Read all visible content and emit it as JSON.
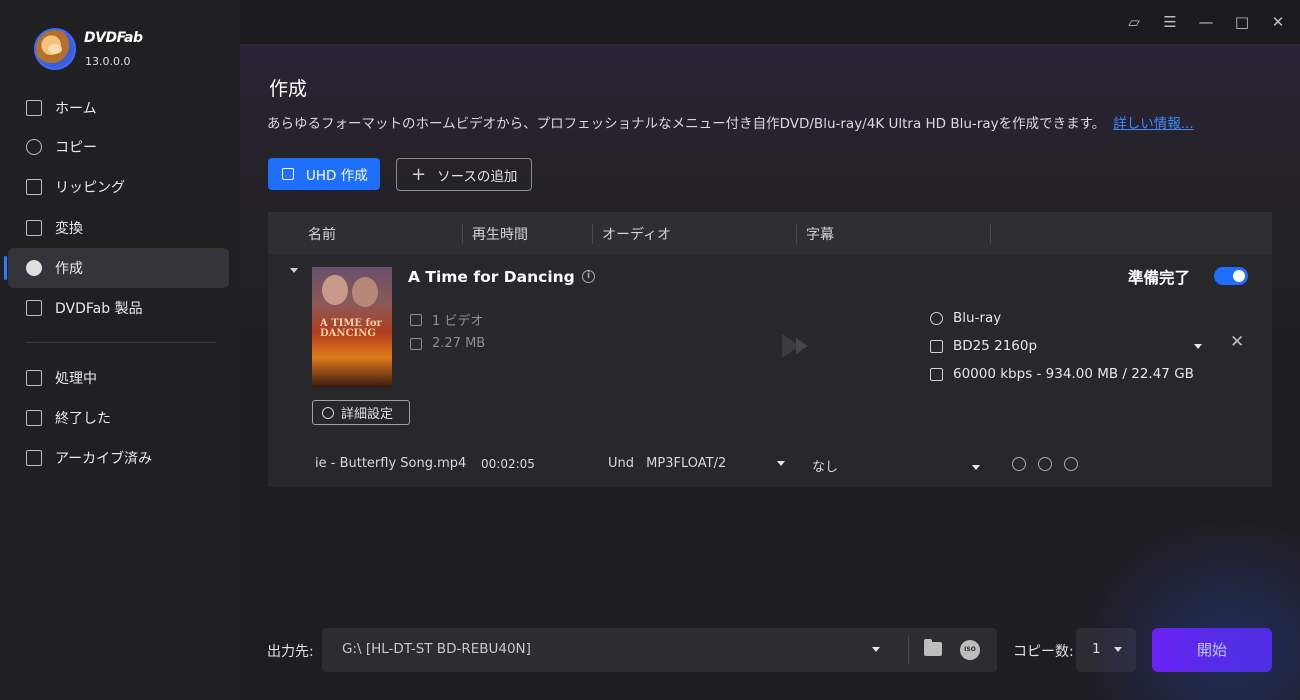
{
  "app": {
    "brand": "DVDFab",
    "version": "13.0.0.0"
  },
  "sidebar": {
    "items": [
      {
        "label": "ホーム",
        "icon": "home-icon"
      },
      {
        "label": "コピー",
        "icon": "copy-icon"
      },
      {
        "label": "リッピング",
        "icon": "ripping-icon"
      },
      {
        "label": "変換",
        "icon": "film-icon"
      },
      {
        "label": "作成",
        "icon": "disc-icon",
        "active": true
      },
      {
        "label": "DVDFab 製品",
        "icon": "product-icon"
      },
      {
        "label": "処理中",
        "icon": "processing-icon"
      },
      {
        "label": "終了した",
        "icon": "finished-icon"
      },
      {
        "label": "アーカイブ済み",
        "icon": "archive-icon"
      }
    ]
  },
  "titlebar": {
    "icons": [
      "skin-icon",
      "menu-icon",
      "minimize-icon",
      "maximize-icon",
      "close-icon"
    ]
  },
  "main": {
    "title": "作成",
    "description": "あらゆるフォーマットのホームビデオから、プロフェッショナルなメニュー付き自作DVD/Blu-ray/4K Ultra HD Blu-rayを作成できます。",
    "more_link": "詳しい情報...",
    "uhd_button": "UHD 作成",
    "add_source_button": "ソースの追加"
  },
  "table": {
    "headers": [
      "名前",
      "再生時間",
      "オーディオ",
      "字幕"
    ],
    "item": {
      "title": "A Time for Dancing",
      "poster_text": "A TIME for DANCING",
      "video_count": "1 ビデオ",
      "size": "2.27 MB",
      "status": "準備完了",
      "toggle_on": true,
      "output_format": "Blu-ray",
      "output_disc": "BD25 2160p",
      "output_bitrate": "60000 kbps - 934.00 MB / 22.47 GB",
      "advanced_button": "詳細設定",
      "track": {
        "filename": "ie - Butterfly Song.mp4",
        "duration": "00:02:05",
        "audio_lang": "Und",
        "audio_codec": "MP3FLOAT/2",
        "subtitle": "なし"
      }
    }
  },
  "bottom": {
    "output_label": "出力先:",
    "output_path": "G:\\ [HL-DT-ST BD-REBU40N]",
    "iso_label": "ISO",
    "copies_label": "コピー数:",
    "copies_value": "1",
    "start_button": "開始"
  },
  "colors": {
    "accent": "#1f6fff",
    "start": "#7a1cff",
    "link": "#3f8cff"
  }
}
